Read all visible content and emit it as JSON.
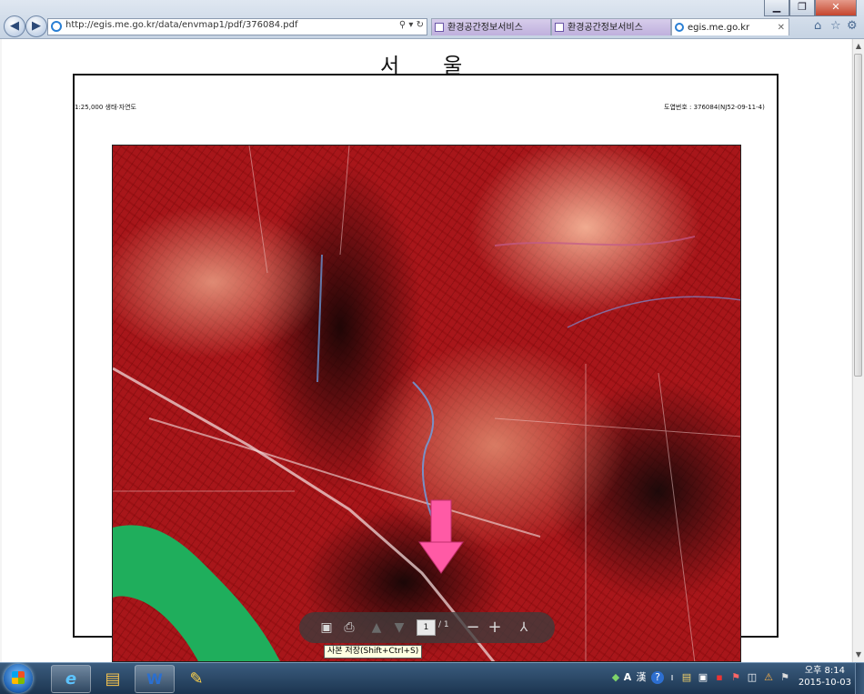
{
  "browser": {
    "window_controls": [
      "▁",
      "❐",
      "✕"
    ],
    "back_glyph": "◀",
    "forward_glyph": "▶",
    "address": "http://egis.me.go.kr/data/envmap1/pdf/376084.pdf",
    "address_controls": "⚲ ▾ ↻",
    "tabs": [
      {
        "label": "환경공간정보서비스",
        "active": false
      },
      {
        "label": "환경공간정보서비스",
        "active": false
      },
      {
        "label": "egis.me.go.kr",
        "active": true
      }
    ],
    "tab_close": "✕",
    "right_icons": [
      "home-icon",
      "favorites-star-icon",
      "tools-gear-icon"
    ],
    "right_glyphs": [
      "⌂",
      "☆",
      "⚙"
    ]
  },
  "document": {
    "scale_label": "1:25,000 생태·자연도",
    "title": "서울",
    "map_number": "도엽번호 : 376084(NJ52-09-11-4)",
    "pages": {
      "current": "1",
      "total": "/ 1"
    }
  },
  "pdf_toolbar": {
    "tooltip": "사본 저장(Shift+Ctrl+S)",
    "icons": [
      "save-icon",
      "print-icon",
      "previous-page-icon",
      "next-page-icon",
      "zoom-out-icon",
      "zoom-in-icon",
      "acrobat-icon"
    ],
    "glyphs": {
      "save": "▣",
      "print": "⎙",
      "prev": "▲",
      "next": "▼",
      "zoom_out": "−",
      "zoom_in": "+",
      "acrobat": "⅄"
    }
  },
  "annotation": {
    "arrow_color": "#ff5aa5"
  },
  "taskbar": {
    "pinned": [
      "internet-explorer-icon",
      "file-explorer-icon",
      "word-icon",
      "paint-icon"
    ],
    "glyphs": {
      "ie": "e",
      "explorer": "▤",
      "word": "W",
      "paint": "✎"
    },
    "tray_glyphs": [
      "A",
      "漢",
      "?",
      "ı",
      "▤",
      "▣",
      "▪",
      "⚑",
      "◫",
      "⚠",
      "⚑",
      "🔊"
    ],
    "clock": {
      "time": "오후 8:14",
      "date": "2015-10-03"
    }
  },
  "colors": {
    "map_red": "#a8161a",
    "river_green": "#1fae5c",
    "tab_inactive": "#c9bce3"
  }
}
